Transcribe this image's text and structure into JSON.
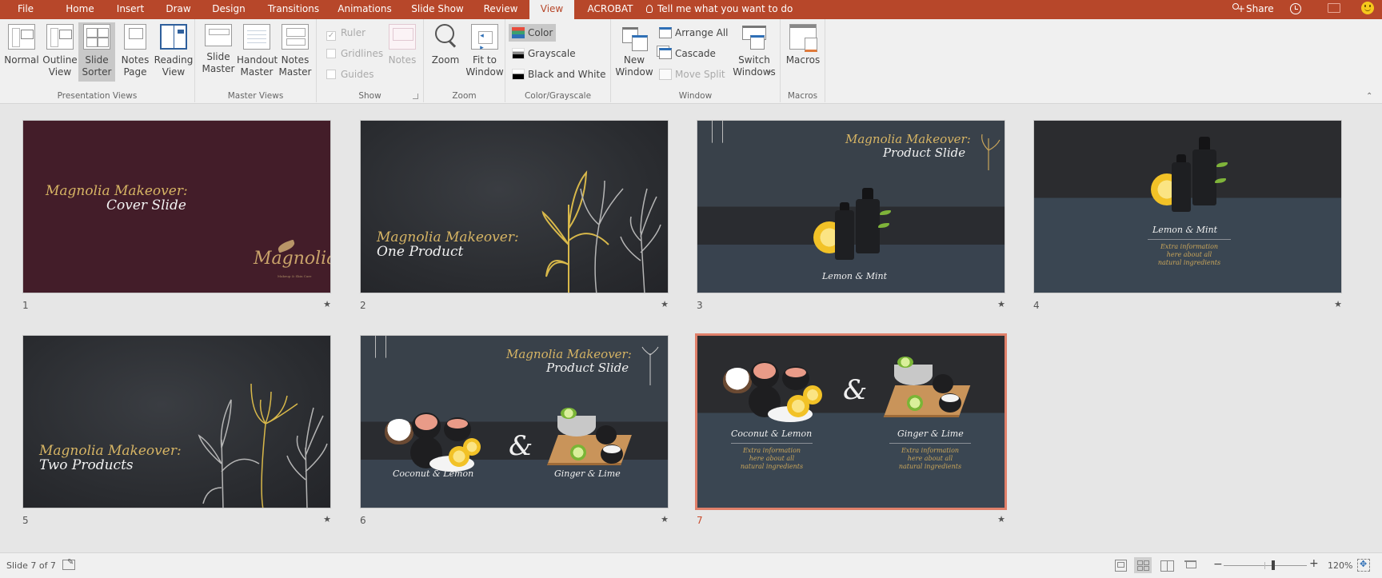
{
  "tabs": [
    {
      "label": "File",
      "active": false
    },
    {
      "label": "Home",
      "active": false
    },
    {
      "label": "Insert",
      "active": false
    },
    {
      "label": "Draw",
      "active": false
    },
    {
      "label": "Design",
      "active": false
    },
    {
      "label": "Transitions",
      "active": false
    },
    {
      "label": "Animations",
      "active": false
    },
    {
      "label": "Slide Show",
      "active": false
    },
    {
      "label": "Review",
      "active": false
    },
    {
      "label": "View",
      "active": true
    },
    {
      "label": "ACROBAT",
      "active": false
    }
  ],
  "tell_me": "Tell me what you want to do",
  "share_label": "Share",
  "colors": {
    "accent": "#b7472a",
    "ribbon_bg": "#f0f0f0",
    "selection_border": "#e0806a"
  },
  "ribbon": {
    "presentation_views": {
      "label": "Presentation Views",
      "buttons": [
        {
          "label": "Normal",
          "icon": "normal-view-icon"
        },
        {
          "label": "Outline\nView",
          "icon": "outline-view-icon"
        },
        {
          "label": "Slide\nSorter",
          "icon": "slide-sorter-icon",
          "selected": true
        },
        {
          "label": "Notes\nPage",
          "icon": "notes-page-icon"
        },
        {
          "label": "Reading\nView",
          "icon": "reading-view-icon"
        }
      ]
    },
    "master_views": {
      "label": "Master Views",
      "buttons": [
        {
          "label": "Slide\nMaster",
          "icon": "slide-master-icon"
        },
        {
          "label": "Handout\nMaster",
          "icon": "handout-master-icon"
        },
        {
          "label": "Notes\nMaster",
          "icon": "notes-master-icon"
        }
      ]
    },
    "show": {
      "label": "Show",
      "checkboxes": [
        {
          "label": "Ruler",
          "checked": true,
          "disabled": true
        },
        {
          "label": "Gridlines",
          "checked": false,
          "disabled": true
        },
        {
          "label": "Guides",
          "checked": false,
          "disabled": true
        }
      ],
      "notes_label": "Notes"
    },
    "zoom": {
      "label": "Zoom",
      "zoom_label": "Zoom",
      "fit_label": "Fit to\nWindow"
    },
    "color_grayscale": {
      "label": "Color/Grayscale",
      "options": [
        {
          "label": "Color",
          "selected": true
        },
        {
          "label": "Grayscale",
          "selected": false
        },
        {
          "label": "Black and White",
          "selected": false
        }
      ]
    },
    "window": {
      "label": "Window",
      "new_window": "New\nWindow",
      "arrange_all": "Arrange All",
      "cascade": "Cascade",
      "move_split": "Move Split",
      "switch_windows": "Switch\nWindows"
    },
    "macros": {
      "label": "Macros",
      "macros_label": "Macros"
    }
  },
  "slides": [
    {
      "number": "1",
      "title_line1": "Magnolia Makeover:",
      "title_line2": "Cover Slide",
      "logo": "Magnolia",
      "logo_sub": "Makeup & Skin Care"
    },
    {
      "number": "2",
      "title_line1": "Magnolia Makeover:",
      "title_line2": "One Product"
    },
    {
      "number": "3",
      "title_line1": "Magnolia Makeover:",
      "title_line2": "Product Slide",
      "product": "Lemon & Mint"
    },
    {
      "number": "4",
      "product": "Lemon & Mint",
      "extra": "Extra information\nhere about all\nnatural ingredients"
    },
    {
      "number": "5",
      "title_line1": "Magnolia Makeover:",
      "title_line2": "Two Products"
    },
    {
      "number": "6",
      "title_line1": "Magnolia Makeover:",
      "title_line2": "Product Slide",
      "product_a": "Coconut & Lemon",
      "product_b": "Ginger & Lime",
      "ampersand": "&"
    },
    {
      "number": "7",
      "product_a": "Coconut & Lemon",
      "product_b": "Ginger & Lime",
      "ampersand": "&",
      "extra_a": "Extra information\nhere about all\nnatural ingredients",
      "extra_b": "Extra information\nhere about all\nnatural ingredients",
      "selected": true
    }
  ],
  "status": {
    "slide_indicator": "Slide 7 of 7",
    "zoom_level": "120%",
    "zoom_fraction": 0.6
  }
}
